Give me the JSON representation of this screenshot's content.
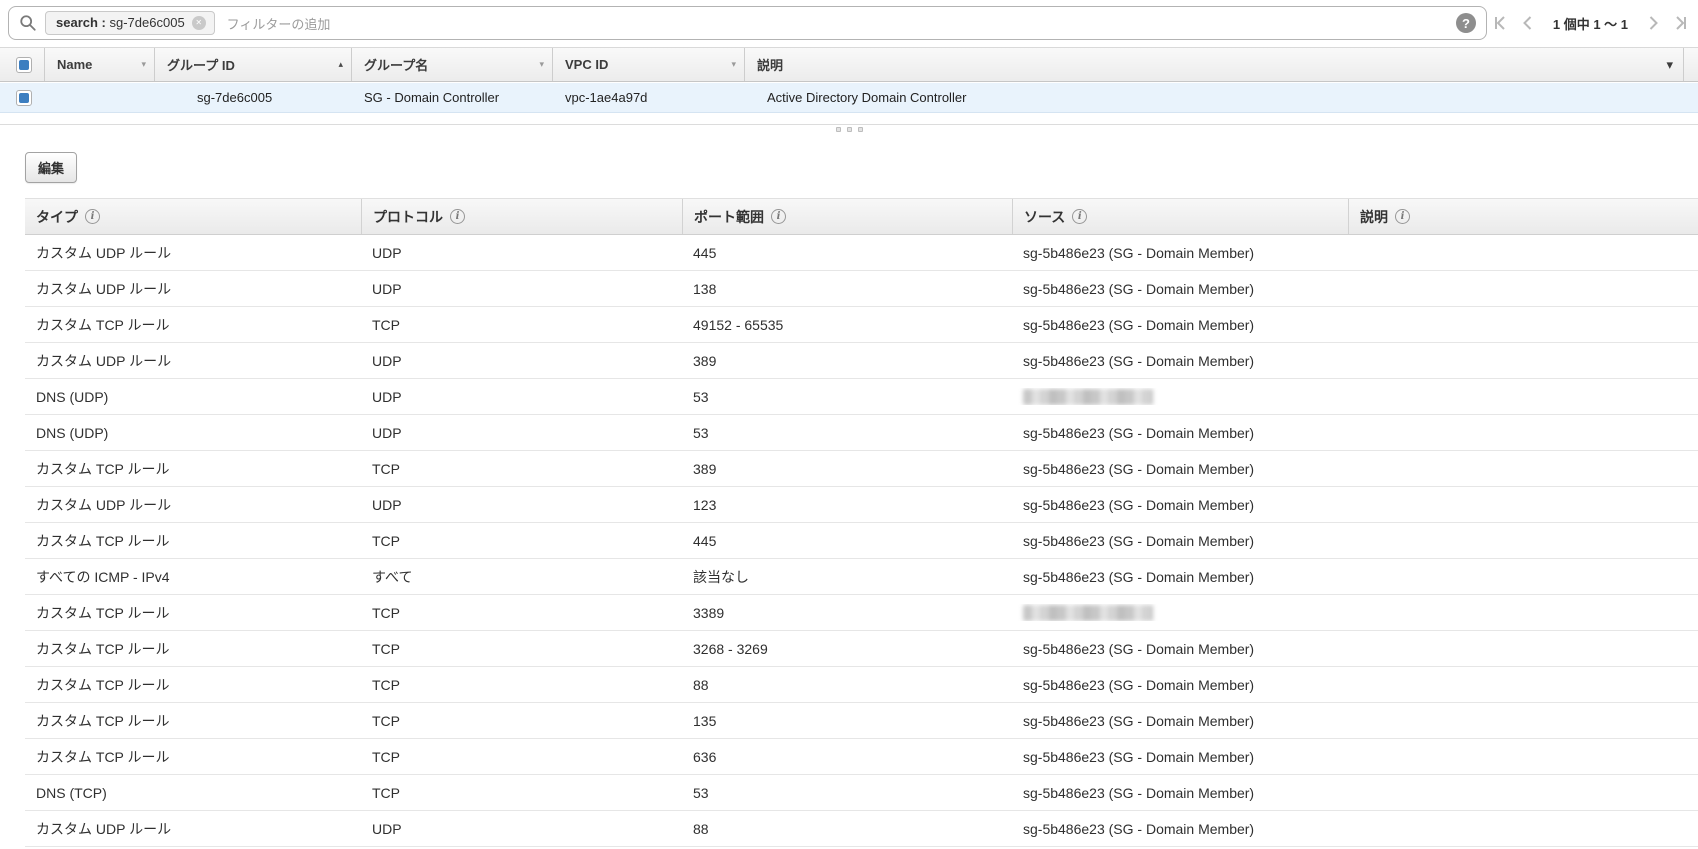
{
  "filter_bar": {
    "search_tag_key": "search :",
    "search_tag_value": "sg-7de6c005",
    "filter_placeholder": "フィルターの追加",
    "pagination_label": "1 個中 1 ～ 1"
  },
  "colors": {
    "accent_blue": "#3c7ec0",
    "selected_row_bg": "#e9f3fc"
  },
  "sg_table": {
    "columns": [
      "Name",
      "グループ ID",
      "グループ名",
      "VPC ID",
      "説明"
    ],
    "sorted_column": "グループ ID",
    "sort_direction": "asc",
    "row": {
      "name": "",
      "group_id": "sg-7de6c005",
      "group_name": "SG - Domain Controller",
      "vpc_id": "vpc-1ae4a97d",
      "description": "Active Directory Domain Controller"
    }
  },
  "actions": {
    "edit_button_label": "編集"
  },
  "rules_table": {
    "columns": [
      "タイプ",
      "プロトコル",
      "ポート範囲",
      "ソース",
      "説明"
    ],
    "rows": [
      {
        "type": "カスタム UDP ルール",
        "protocol": "UDP",
        "port_range": "445",
        "source": "sg-5b486e23 (SG - Domain Member)",
        "source_redacted": false,
        "description": ""
      },
      {
        "type": "カスタム UDP ルール",
        "protocol": "UDP",
        "port_range": "138",
        "source": "sg-5b486e23 (SG - Domain Member)",
        "source_redacted": false,
        "description": ""
      },
      {
        "type": "カスタム TCP ルール",
        "protocol": "TCP",
        "port_range": "49152 - 65535",
        "source": "sg-5b486e23 (SG - Domain Member)",
        "source_redacted": false,
        "description": ""
      },
      {
        "type": "カスタム UDP ルール",
        "protocol": "UDP",
        "port_range": "389",
        "source": "sg-5b486e23 (SG - Domain Member)",
        "source_redacted": false,
        "description": ""
      },
      {
        "type": "DNS (UDP)",
        "protocol": "UDP",
        "port_range": "53",
        "source": "",
        "source_redacted": true,
        "description": ""
      },
      {
        "type": "DNS (UDP)",
        "protocol": "UDP",
        "port_range": "53",
        "source": "sg-5b486e23 (SG - Domain Member)",
        "source_redacted": false,
        "description": ""
      },
      {
        "type": "カスタム TCP ルール",
        "protocol": "TCP",
        "port_range": "389",
        "source": "sg-5b486e23 (SG - Domain Member)",
        "source_redacted": false,
        "description": ""
      },
      {
        "type": "カスタム UDP ルール",
        "protocol": "UDP",
        "port_range": "123",
        "source": "sg-5b486e23 (SG - Domain Member)",
        "source_redacted": false,
        "description": ""
      },
      {
        "type": "カスタム TCP ルール",
        "protocol": "TCP",
        "port_range": "445",
        "source": "sg-5b486e23 (SG - Domain Member)",
        "source_redacted": false,
        "description": ""
      },
      {
        "type": "すべての ICMP - IPv4",
        "protocol": "すべて",
        "port_range": "該当なし",
        "source": "sg-5b486e23 (SG - Domain Member)",
        "source_redacted": false,
        "description": ""
      },
      {
        "type": "カスタム TCP ルール",
        "protocol": "TCP",
        "port_range": "3389",
        "source": "",
        "source_redacted": true,
        "description": ""
      },
      {
        "type": "カスタム TCP ルール",
        "protocol": "TCP",
        "port_range": "3268 - 3269",
        "source": "sg-5b486e23 (SG - Domain Member)",
        "source_redacted": false,
        "description": ""
      },
      {
        "type": "カスタム TCP ルール",
        "protocol": "TCP",
        "port_range": "88",
        "source": "sg-5b486e23 (SG - Domain Member)",
        "source_redacted": false,
        "description": ""
      },
      {
        "type": "カスタム TCP ルール",
        "protocol": "TCP",
        "port_range": "135",
        "source": "sg-5b486e23 (SG - Domain Member)",
        "source_redacted": false,
        "description": ""
      },
      {
        "type": "カスタム TCP ルール",
        "protocol": "TCP",
        "port_range": "636",
        "source": "sg-5b486e23 (SG - Domain Member)",
        "source_redacted": false,
        "description": ""
      },
      {
        "type": "DNS (TCP)",
        "protocol": "TCP",
        "port_range": "53",
        "source": "sg-5b486e23 (SG - Domain Member)",
        "source_redacted": false,
        "description": ""
      },
      {
        "type": "カスタム UDP ルール",
        "protocol": "UDP",
        "port_range": "88",
        "source": "sg-5b486e23 (SG - Domain Member)",
        "source_redacted": false,
        "description": ""
      }
    ]
  }
}
